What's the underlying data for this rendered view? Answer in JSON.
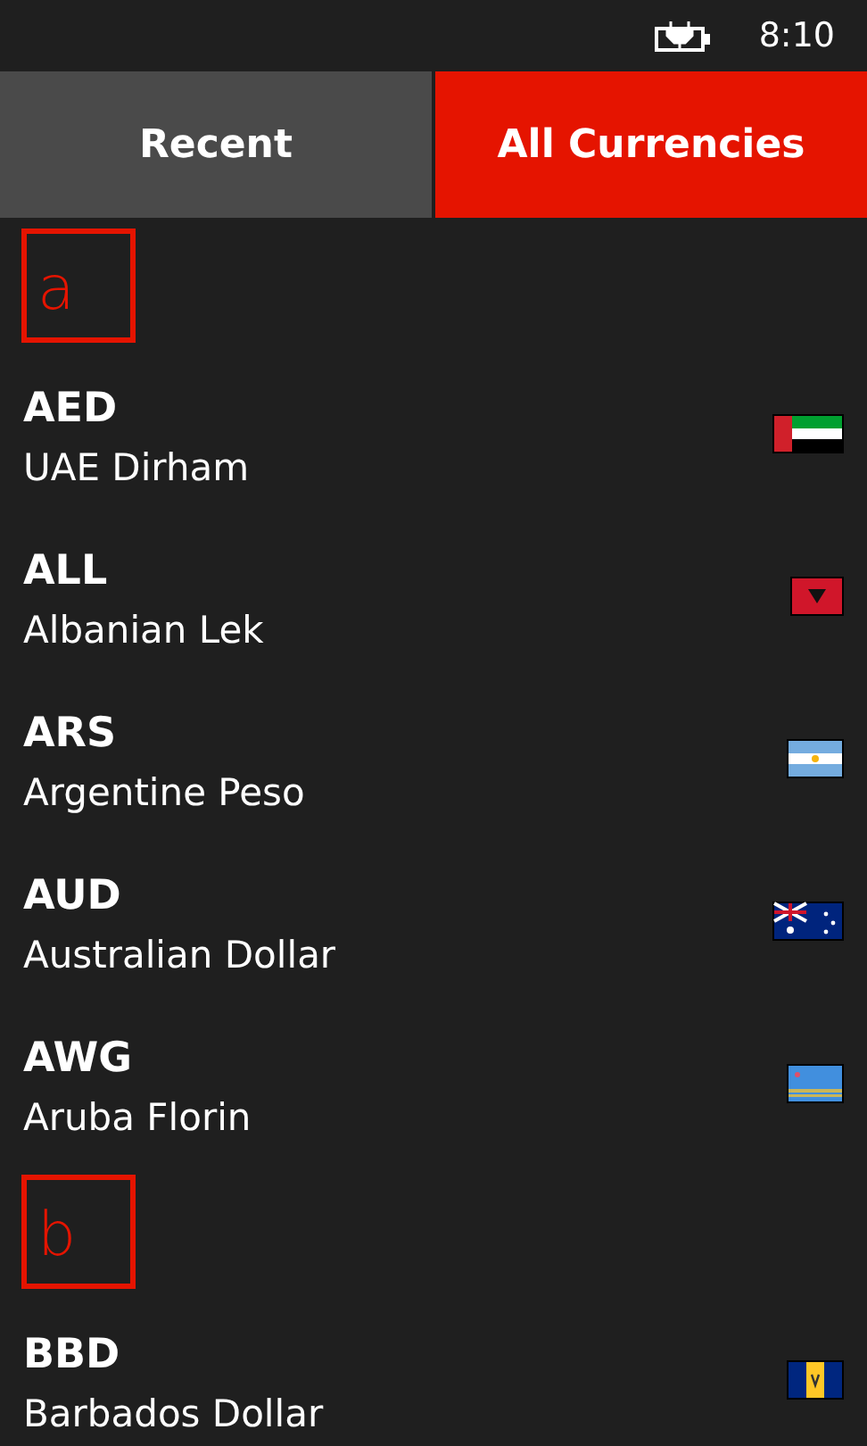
{
  "status_bar": {
    "time": "8:10"
  },
  "tabs": [
    {
      "label": "Recent",
      "selected": false
    },
    {
      "label": "All Currencies",
      "selected": true
    }
  ],
  "groups": [
    {
      "letter": "a",
      "currencies": [
        {
          "code": "AED",
          "name": "UAE Dirham",
          "kind": "aed"
        },
        {
          "code": "ALL",
          "name": "Albanian Lek",
          "kind": "all"
        },
        {
          "code": "ARS",
          "name": "Argentine Peso",
          "kind": "ars"
        },
        {
          "code": "AUD",
          "name": "Australian Dollar",
          "kind": "aud"
        },
        {
          "code": "AWG",
          "name": "Aruba Florin",
          "kind": "awg"
        }
      ]
    },
    {
      "letter": "b",
      "currencies": [
        {
          "code": "BBD",
          "name": "Barbados Dollar",
          "kind": "bbd"
        }
      ]
    }
  ]
}
